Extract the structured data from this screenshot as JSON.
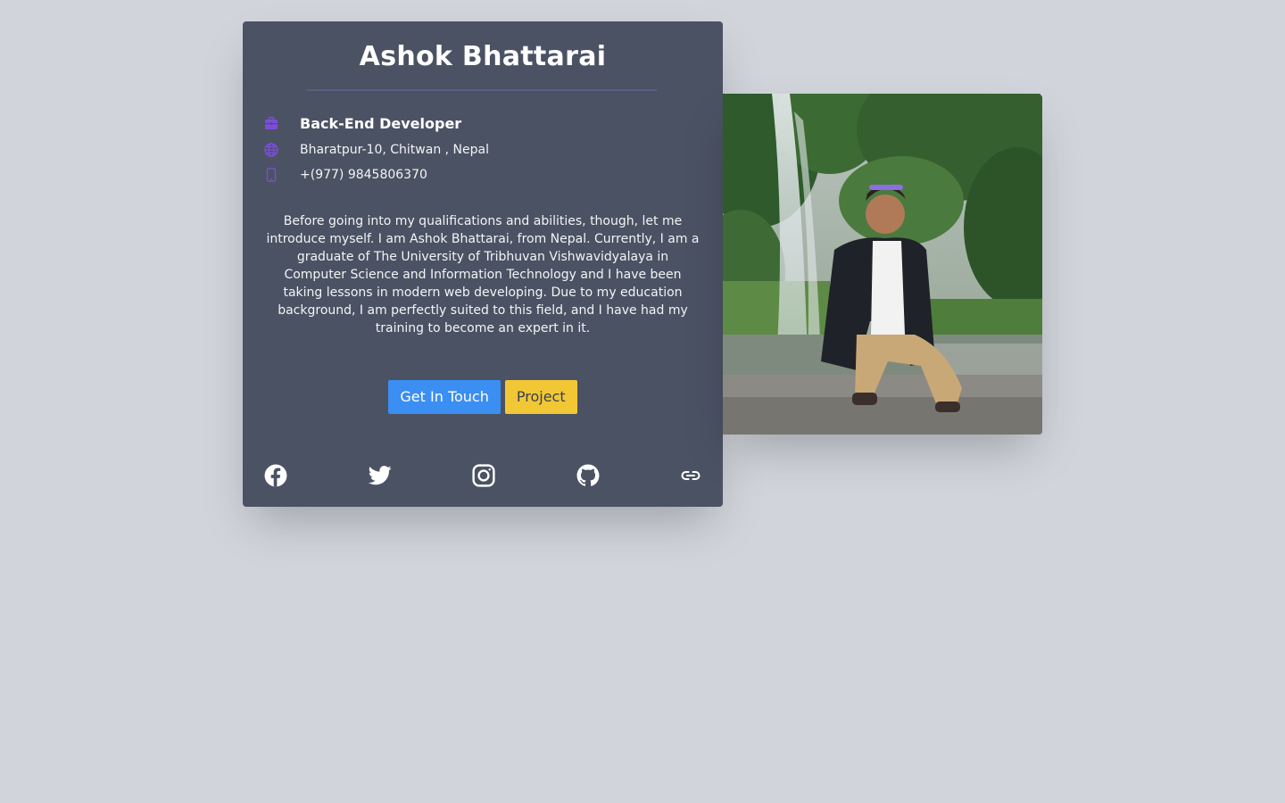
{
  "profile": {
    "name": "Ashok Bhattarai",
    "role": "Back-End Developer",
    "location": "Bharatpur-10, Chitwan , Nepal",
    "phone": "+(977) 9845806370",
    "bio": "Before going into my qualifications and abilities, though, let me introduce myself. I am Ashok Bhattarai, from Nepal. Currently, I am a graduate of The University of Tribhuvan Vishwavidyalaya in Computer Science and Information Technology and I have been taking lessons in modern web developing. Due to my education background, I am perfectly suited to this field, and I have had my training to become an expert in it."
  },
  "buttons": {
    "get_in_touch": "Get In Touch",
    "project": "Project"
  },
  "icons": {
    "role": "briefcase-icon",
    "location": "globe-icon",
    "phone": "mobile-phone-icon",
    "social": [
      "facebook-icon",
      "twitter-icon",
      "instagram-icon",
      "github-icon",
      "link-icon"
    ]
  },
  "photo": {
    "subject": "profile-photo"
  },
  "colors": {
    "background": "#d1d5db",
    "card": "#4b5263",
    "accent_icon": "#7c4ddb",
    "button_primary": "#3b8ef2",
    "button_secondary": "#f2c735"
  }
}
